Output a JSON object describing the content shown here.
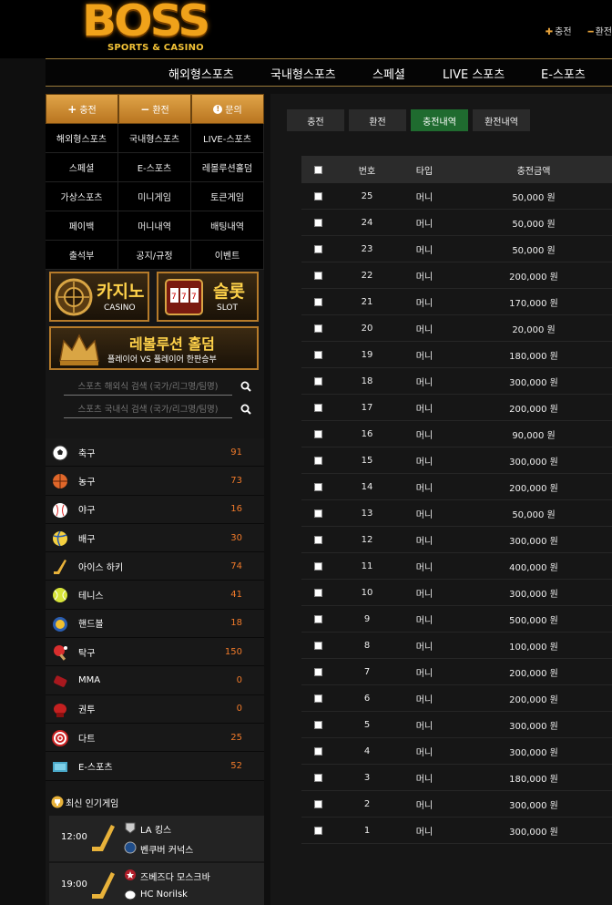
{
  "brand": {
    "logo_big": "BOSS",
    "logo_small": "SPORTS & CASINO"
  },
  "top_links": [
    {
      "label": "충전"
    },
    {
      "label": "환전"
    }
  ],
  "nav": [
    "해외형스포츠",
    "국내형스포츠",
    "스페셜",
    "LIVE 스포츠",
    "E-스포츠"
  ],
  "sidebar": {
    "tab_buttons": [
      "충전",
      "환전",
      "문의"
    ],
    "menu": [
      "해외형스포츠",
      "국내형스포츠",
      "LIVE-스포츠",
      "스페셜",
      "E-스포츠",
      "레볼루션홀덤",
      "가상스포츠",
      "미니게임",
      "토큰게임",
      "페이백",
      "머니내역",
      "배팅내역",
      "출석부",
      "공지/규정",
      "이벤트"
    ],
    "banners": {
      "casino_title": "카지노",
      "casino_sub": "CASINO",
      "slot_title": "슬롯",
      "slot_sub": "SLOT",
      "holdem_title": "레볼루션 홀덤",
      "holdem_sub": "플레이어 VS 플레이어 한판승부"
    },
    "search": [
      {
        "placeholder": "스포츠 해외식 검색 (국가/리그명/팀명)"
      },
      {
        "placeholder": "스포츠 국내식 검색 (국가/리그명/팀명)"
      }
    ],
    "sports": [
      {
        "name": "축구",
        "count": "91",
        "icon": "soccer-ball-icon"
      },
      {
        "name": "농구",
        "count": "73",
        "icon": "basketball-icon"
      },
      {
        "name": "야구",
        "count": "16",
        "icon": "baseball-icon"
      },
      {
        "name": "배구",
        "count": "30",
        "icon": "volleyball-icon"
      },
      {
        "name": "아이스 하키",
        "count": "74",
        "icon": "hockey-stick-icon"
      },
      {
        "name": "테니스",
        "count": "41",
        "icon": "tennis-ball-icon"
      },
      {
        "name": "핸드볼",
        "count": "18",
        "icon": "handball-icon"
      },
      {
        "name": "탁구",
        "count": "150",
        "icon": "ping-pong-icon"
      },
      {
        "name": "MMA",
        "count": "0",
        "icon": "mma-glove-icon"
      },
      {
        "name": "권투",
        "count": "0",
        "icon": "boxing-glove-icon"
      },
      {
        "name": "다트",
        "count": "25",
        "icon": "dart-icon"
      },
      {
        "name": "E-스포츠",
        "count": "52",
        "icon": "esports-icon"
      }
    ],
    "popular_title": "최신 인기게임",
    "games": [
      {
        "time": "12:00",
        "home": "LA 킹스",
        "away": "벤쿠버 커넉스"
      },
      {
        "time": "19:00",
        "home": "즈베즈다 모스크바",
        "away": "HC Norilsk"
      }
    ]
  },
  "main": {
    "tabs": [
      "충전",
      "환전",
      "충전내역",
      "환전내역"
    ],
    "active_tab": "충전내역",
    "columns": [
      "번호",
      "타입",
      "충전금액"
    ],
    "rows": [
      {
        "no": "25",
        "type": "머니",
        "amount": "50,000 원"
      },
      {
        "no": "24",
        "type": "머니",
        "amount": "50,000 원"
      },
      {
        "no": "23",
        "type": "머니",
        "amount": "50,000 원"
      },
      {
        "no": "22",
        "type": "머니",
        "amount": "200,000 원"
      },
      {
        "no": "21",
        "type": "머니",
        "amount": "170,000 원"
      },
      {
        "no": "20",
        "type": "머니",
        "amount": "20,000 원"
      },
      {
        "no": "19",
        "type": "머니",
        "amount": "180,000 원"
      },
      {
        "no": "18",
        "type": "머니",
        "amount": "300,000 원"
      },
      {
        "no": "17",
        "type": "머니",
        "amount": "200,000 원"
      },
      {
        "no": "16",
        "type": "머니",
        "amount": "90,000 원"
      },
      {
        "no": "15",
        "type": "머니",
        "amount": "300,000 원"
      },
      {
        "no": "14",
        "type": "머니",
        "amount": "200,000 원"
      },
      {
        "no": "13",
        "type": "머니",
        "amount": "50,000 원"
      },
      {
        "no": "12",
        "type": "머니",
        "amount": "300,000 원"
      },
      {
        "no": "11",
        "type": "머니",
        "amount": "400,000 원"
      },
      {
        "no": "10",
        "type": "머니",
        "amount": "300,000 원"
      },
      {
        "no": "9",
        "type": "머니",
        "amount": "500,000 원"
      },
      {
        "no": "8",
        "type": "머니",
        "amount": "100,000 원"
      },
      {
        "no": "7",
        "type": "머니",
        "amount": "200,000 원"
      },
      {
        "no": "6",
        "type": "머니",
        "amount": "200,000 원"
      },
      {
        "no": "5",
        "type": "머니",
        "amount": "300,000 원"
      },
      {
        "no": "4",
        "type": "머니",
        "amount": "300,000 원"
      },
      {
        "no": "3",
        "type": "머니",
        "amount": "180,000 원"
      },
      {
        "no": "2",
        "type": "머니",
        "amount": "300,000 원"
      },
      {
        "no": "1",
        "type": "머니",
        "amount": "300,000 원"
      }
    ]
  },
  "colors": {
    "accent": "#e0a448",
    "active_tab": "#1f6b2f",
    "count": "#f07a2a"
  }
}
